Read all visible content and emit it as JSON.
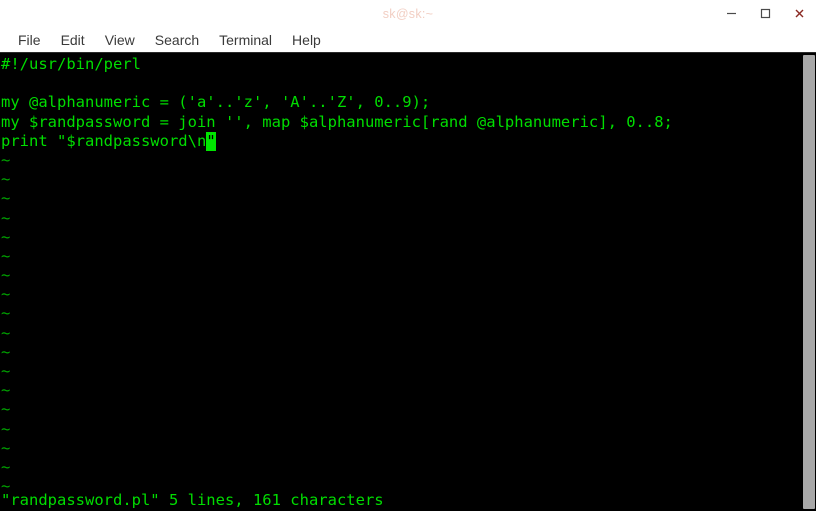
{
  "window": {
    "title": "sk@sk:~",
    "controls": [
      {
        "name": "minimize",
        "glyph": "–"
      },
      {
        "name": "maximize",
        "glyph": "□"
      },
      {
        "name": "close",
        "glyph": "✕"
      }
    ]
  },
  "menubar": {
    "items": [
      {
        "label": "File"
      },
      {
        "label": "Edit"
      },
      {
        "label": "View"
      },
      {
        "label": "Search"
      },
      {
        "label": "Terminal"
      },
      {
        "label": "Help"
      }
    ]
  },
  "terminal": {
    "colors": {
      "background": "#000000",
      "foreground": "#00dd00",
      "cursor": "#00e500",
      "tilde": "#00a800"
    },
    "lines": [
      "#!/usr/bin/perl",
      "",
      "my @alphanumeric = ('a'..'z', 'A'..'Z', 0..9);",
      "my $randpassword = join '', map $alphanumeric[rand @alphanumeric], 0..8;"
    ],
    "cursor_line": {
      "before": "print \"$randpassword\\n",
      "cursor_char": "\"",
      "after": ""
    },
    "tilde_char": "~",
    "tilde_count": 18,
    "statusline": "\"randpassword.pl\" 5 lines, 161 characters"
  }
}
